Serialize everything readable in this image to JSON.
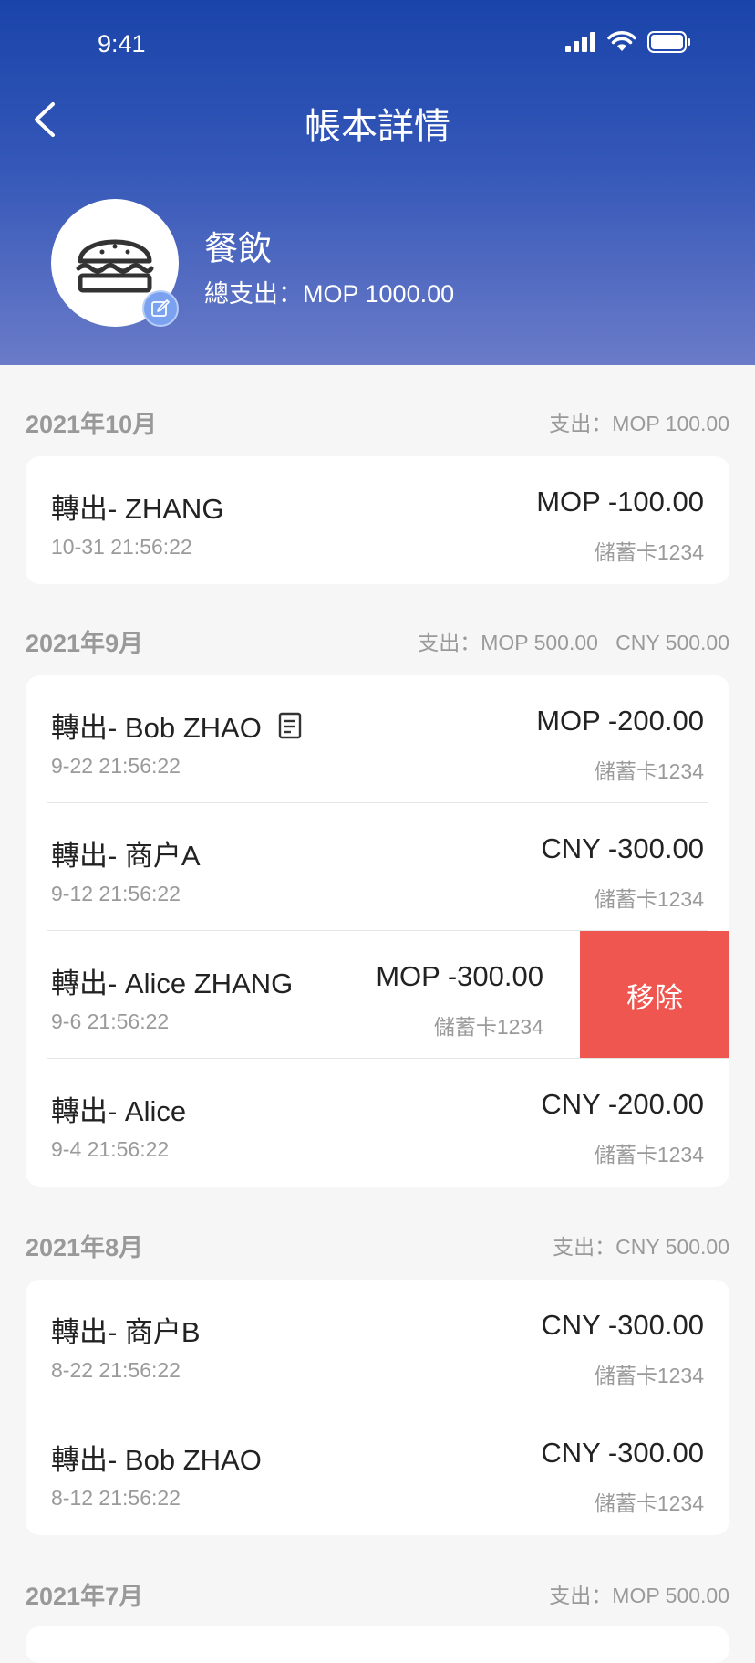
{
  "status": {
    "time": "9:41"
  },
  "nav": {
    "title": "帳本詳情"
  },
  "book": {
    "name": "餐飲",
    "total": "總支出：MOP 1000.00"
  },
  "sections": [
    {
      "month": "2021年10月",
      "summary": "支出：MOP 100.00",
      "items": [
        {
          "name": "轉出- ZHANG",
          "time": "10-31 21:56:22",
          "amount": "MOP -100.00",
          "card": "儲蓄卡1234"
        }
      ]
    },
    {
      "month": "2021年9月",
      "summary": "支出：MOP 500.00   CNY 500.00",
      "items": [
        {
          "name": "轉出- Bob ZHAO",
          "time": "9-22 21:56:22",
          "amount": "MOP -200.00",
          "card": "儲蓄卡1234"
        },
        {
          "name": "轉出- 商户A",
          "time": "9-12 21:56:22",
          "amount": "CNY -300.00",
          "card": "儲蓄卡1234"
        },
        {
          "name": "轉出- Alice ZHANG",
          "time": "9-6 21:56:22",
          "amount": "MOP -300.00",
          "card": "儲蓄卡1234",
          "action": "移除"
        },
        {
          "name": "轉出- Alice",
          "time": "9-4 21:56:22",
          "amount": "CNY -200.00",
          "card": "儲蓄卡1234"
        }
      ]
    },
    {
      "month": "2021年8月",
      "summary": "支出：CNY 500.00",
      "items": [
        {
          "name": "轉出- 商户B",
          "time": "8-22 21:56:22",
          "amount": "CNY -300.00",
          "card": "儲蓄卡1234"
        },
        {
          "name": "轉出- Bob ZHAO",
          "time": "8-12 21:56:22",
          "amount": "CNY -300.00",
          "card": "儲蓄卡1234"
        }
      ]
    },
    {
      "month": "2021年7月",
      "summary": "支出：MOP 500.00",
      "items": []
    }
  ],
  "colors": {
    "header_top": "#1a44aa",
    "header_bottom": "#6a7bc8",
    "remove": "#f05650"
  }
}
